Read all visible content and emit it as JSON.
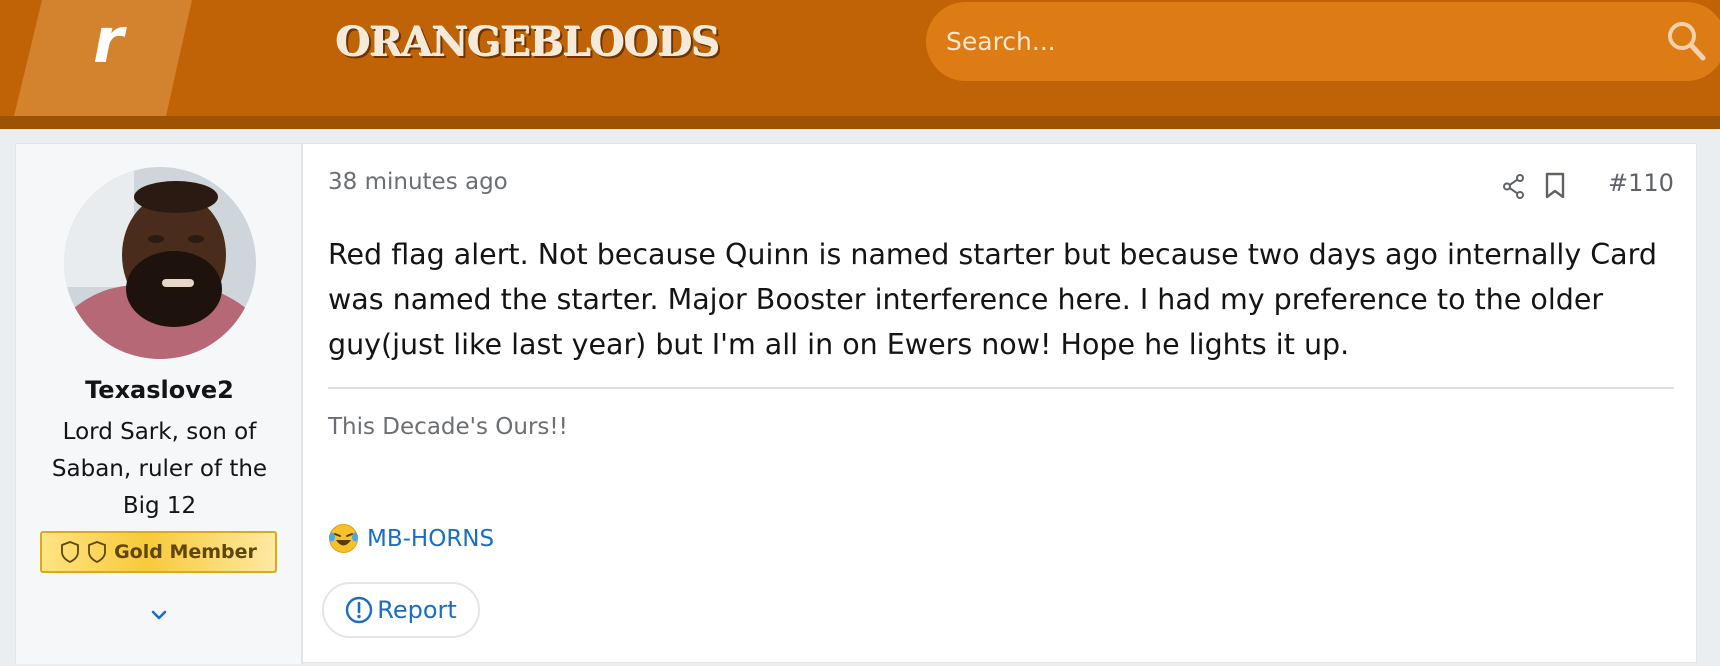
{
  "header": {
    "site_name": "ORANGEBLOODS",
    "search": {
      "placeholder": "Search..."
    }
  },
  "post": {
    "author": {
      "username": "Texaslove2",
      "title": "Lord Sark, son of Saban, ruler of the Big 12",
      "badge": "Gold Member"
    },
    "timestamp": "38 minutes ago",
    "post_number": "#110",
    "body": "Red flag alert. Not because Quinn is named starter but because two days ago internally Card was named the starter. Major Booster interference here. I had my preference to the older guy(just like last year) but I'm all in on Ewers now! Hope he lights it up.",
    "signature": "This Decade's Ours!!",
    "reactions": [
      {
        "emoji": "laughing-crying-emoji",
        "user": "MB-HORNS"
      }
    ],
    "report_label": "Report"
  },
  "icons": {
    "logo": "rivals-r-logo",
    "search": "search-icon",
    "share": "share-icon",
    "bookmark": "bookmark-icon",
    "expand": "chevron-down-icon",
    "report": "exclamation-circle-icon",
    "badge": "shield-icon"
  },
  "colors": {
    "header_bg": "#c06306",
    "header_strip": "#9d5204",
    "search_bg": "#dd7b15",
    "link": "#1a6fc2",
    "badge_gold": "#f8c93a"
  }
}
